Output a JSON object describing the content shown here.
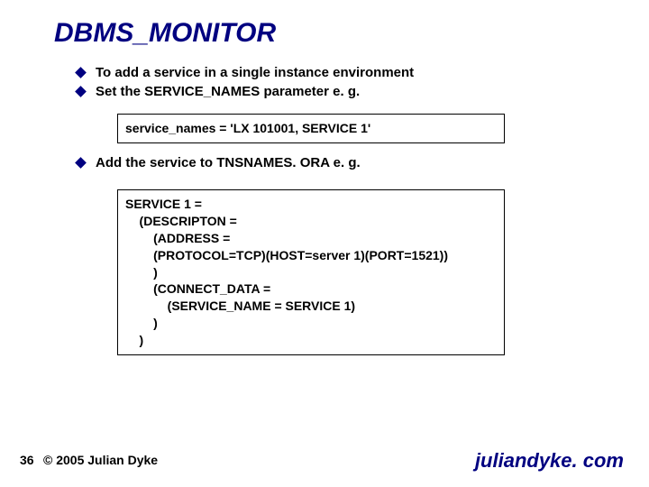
{
  "title": "DBMS_MONITOR",
  "bullets1": [
    "To add a service in a single instance environment",
    "Set the SERVICE_NAMES parameter e. g."
  ],
  "code1": "service_names = 'LX 101001, SERVICE 1'",
  "bullets2": [
    "Add the service to TNSNAMES. ORA e. g."
  ],
  "code2": "SERVICE 1 =\n    (DESCRIPTON =\n        (ADDRESS =\n        (PROTOCOL=TCP)(HOST=server 1)(PORT=1521))\n        )\n        (CONNECT_DATA =\n            (SERVICE_NAME = SERVICE 1)\n        )\n    )",
  "footer": {
    "page": "36",
    "copyright": "© 2005 Julian Dyke",
    "site": "juliandyke. com"
  }
}
